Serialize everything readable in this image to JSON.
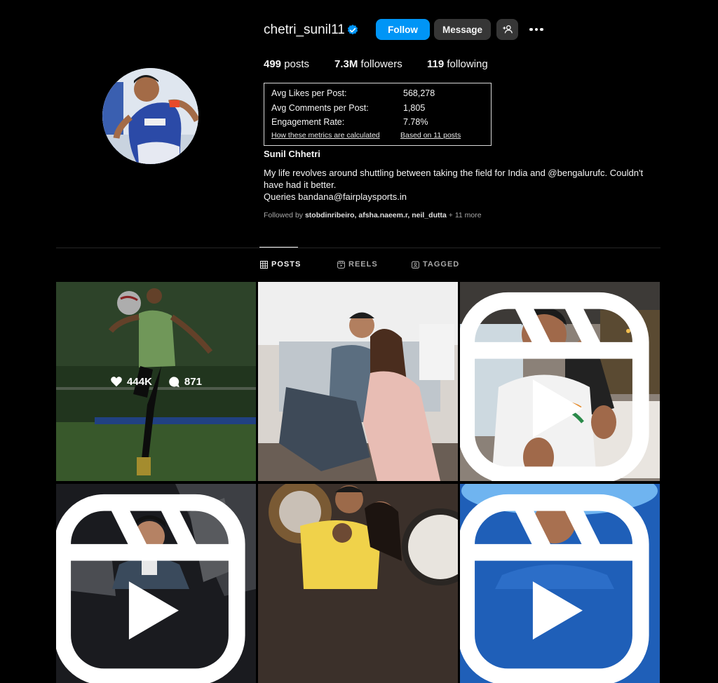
{
  "profile": {
    "username": "chetri_sunil11",
    "full_name": "Sunil Chhetri",
    "bio_line1": "My life revolves around shuttling between taking the field for India and @bengalurufc. Couldn't have had it better.",
    "bio_line2": "Queries bandana@fairplaysports.in",
    "followed_by_label": "Followed by",
    "followed_by_names": "stobdinribeiro, afsha.naeem.r, neil_dutta",
    "followed_by_more": "+ 11 more"
  },
  "actions": {
    "follow": "Follow",
    "message": "Message"
  },
  "stats": {
    "posts_count": "499",
    "posts_label": "posts",
    "followers_count": "7.3M",
    "followers_label": "followers",
    "following_count": "119",
    "following_label": "following"
  },
  "metrics": {
    "avg_likes_label": "Avg Likes per Post:",
    "avg_likes_value": "568,278",
    "avg_comments_label": "Avg Comments per Post:",
    "avg_comments_value": "1,805",
    "engagement_label": "Engagement Rate:",
    "engagement_value": "7.78%",
    "how_link": "How these metrics are calculated",
    "based_link": "Based on 11 posts"
  },
  "tabs": [
    {
      "label": "POSTS",
      "active": true
    },
    {
      "label": "REELS",
      "active": false
    },
    {
      "label": "TAGGED",
      "active": false
    }
  ],
  "grid": {
    "hover_likes": "444K",
    "hover_comments": "871"
  },
  "colors": {
    "accent": "#0095f6",
    "background": "#000000",
    "button_secondary": "#363636"
  }
}
